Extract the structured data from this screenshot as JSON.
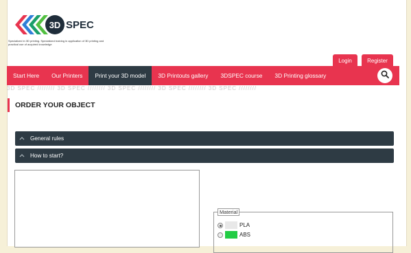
{
  "logo": {
    "text_3d": "3D",
    "text_spec": "SPEC",
    "tagline": "Specialized in 3D printing. Specialized training in application of 3D printing and practical use of acquired knowledge"
  },
  "auth": {
    "login_label": "Login",
    "register_label": "Register"
  },
  "nav": {
    "items": [
      {
        "label": "Start Here"
      },
      {
        "label": "Our Printers"
      },
      {
        "label": "Print your 3D model"
      },
      {
        "label": "3D Printouts gallery"
      },
      {
        "label": "3DSPEC course"
      },
      {
        "label": "3D Printing glossary"
      }
    ],
    "active_index": 2,
    "search_icon": "search-icon"
  },
  "watermark": "3D SPEC //////// 3D SPEC //////// 3D SPEC //////// 3D SPEC //////// 3D SPEC ////////",
  "page": {
    "title": "ORDER YOUR OBJECT"
  },
  "accordion": [
    {
      "label": "General rules"
    },
    {
      "label": "How to start?"
    }
  ],
  "material": {
    "legend": "Material",
    "options": [
      {
        "label": "PLA",
        "swatch": "#e8e8e8",
        "checked": true
      },
      {
        "label": "ABS",
        "swatch": "#22cc44",
        "checked": false
      }
    ]
  },
  "colors": {
    "brand_red": "#e8344f",
    "dark_nav": "#2e3b44"
  }
}
